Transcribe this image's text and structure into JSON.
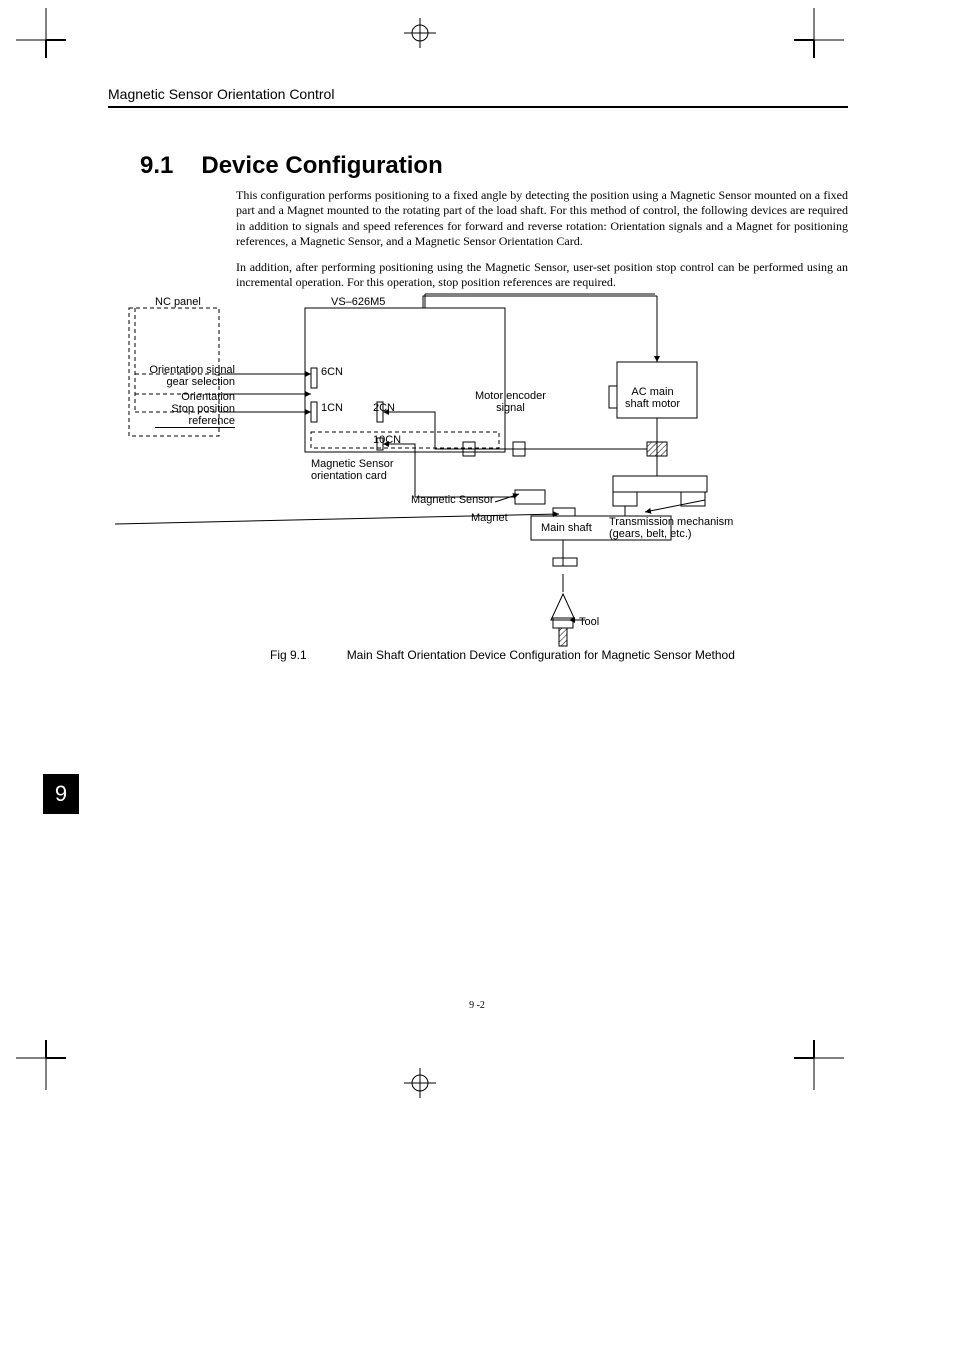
{
  "header": "Magnetic Sensor Orientation Control",
  "section": {
    "number": "9.1",
    "title": "Device Configuration"
  },
  "paragraphs": {
    "p1": "This configuration performs positioning to a fixed angle by detecting the position using a Magnetic Sensor mounted on a fixed part and a Magnet mounted to the rotating part of the load shaft. For this method of control, the following devices are required in addition to signals and speed references for forward and reverse rotation: Orientation signals and a Magnet for positioning references, a Magnetic Sensor, and a Magnetic Sensor Orientation Card.",
    "p2": "In addition, after performing positioning using the Magnetic Sensor, user-set position stop control can be performed using an incremental operation. For this operation, stop position references are required."
  },
  "diagram_labels": {
    "nc_panel": "NC panel",
    "vs": "VS–626M5",
    "orientation_signal_gear": "Orientation signal\ngear selection",
    "orientation": "Orientation",
    "stop_position_ref": "Stop position\nreference",
    "cn6": "6CN",
    "cn1": "1CN",
    "cn2": "2CN",
    "cn10": "10CN",
    "mag_sensor_card": "Magnetic Sensor\norientation card",
    "motor_encoder_signal": "Motor encoder\nsignal",
    "ac_main_shaft_motor": "AC main\nshaft motor",
    "magnetic_sensor": "Magnetic Sensor",
    "magnet": "Magnet",
    "main_shaft": "Main shaft",
    "transmission": "Transmission mechanism\n(gears, belt, etc.)",
    "tool": "Tool"
  },
  "caption": {
    "number": "Fig 9.1",
    "text": "Main Shaft Orientation Device Configuration for Magnetic Sensor Method"
  },
  "chapter_tab": "9",
  "page_number": "9 -2"
}
